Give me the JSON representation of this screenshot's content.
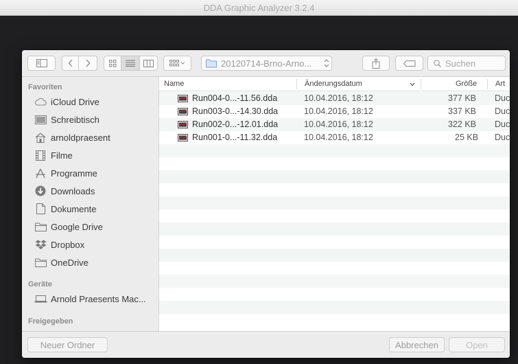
{
  "window": {
    "title": "DDA Graphic Analyzer 3.2.4"
  },
  "toolbar": {
    "path_label": "20120714-Brno-Arno...",
    "search_placeholder": "Suchen"
  },
  "sidebar": {
    "sections": [
      {
        "header": "Favoriten",
        "items": [
          {
            "label": "iCloud Drive",
            "icon": "cloud-icon"
          },
          {
            "label": "Schreibtisch",
            "icon": "desktop-icon"
          },
          {
            "label": "arnoldpraesent",
            "icon": "home-icon"
          },
          {
            "label": "Filme",
            "icon": "film-icon"
          },
          {
            "label": "Programme",
            "icon": "applications-icon"
          },
          {
            "label": "Downloads",
            "icon": "download-icon"
          },
          {
            "label": "Dokumente",
            "icon": "document-icon"
          },
          {
            "label": "Google Drive",
            "icon": "folder-icon"
          },
          {
            "label": "Dropbox",
            "icon": "dropbox-icon"
          },
          {
            "label": "OneDrive",
            "icon": "folder-icon"
          }
        ]
      },
      {
        "header": "Geräte",
        "items": [
          {
            "label": "Arnold Praesents Mac...",
            "icon": "computer-icon"
          }
        ]
      },
      {
        "header": "Freigegeben",
        "items": []
      }
    ]
  },
  "filelist": {
    "columns": {
      "name": "Name",
      "date": "Änderungsdatum",
      "size": "Größe",
      "kind": "Art"
    },
    "rows": [
      {
        "name": "Run004-0...-11.56.dda",
        "date": "10.04.2016, 18:12",
        "size": "377 KB",
        "kind": "Duc"
      },
      {
        "name": "Run003-0...-14.30.dda",
        "date": "10.04.2016, 18:12",
        "size": "337 KB",
        "kind": "Duc"
      },
      {
        "name": "Run002-0...-12.01.dda",
        "date": "10.04.2016, 18:12",
        "size": "322 KB",
        "kind": "Duc"
      },
      {
        "name": "Run001-0...-11.32.dda",
        "date": "10.04.2016, 18:12",
        "size": "25 KB",
        "kind": "Duc"
      }
    ]
  },
  "bottombar": {
    "new_folder": "Neuer Ordner",
    "cancel": "Abbrechen",
    "open": "Open"
  }
}
